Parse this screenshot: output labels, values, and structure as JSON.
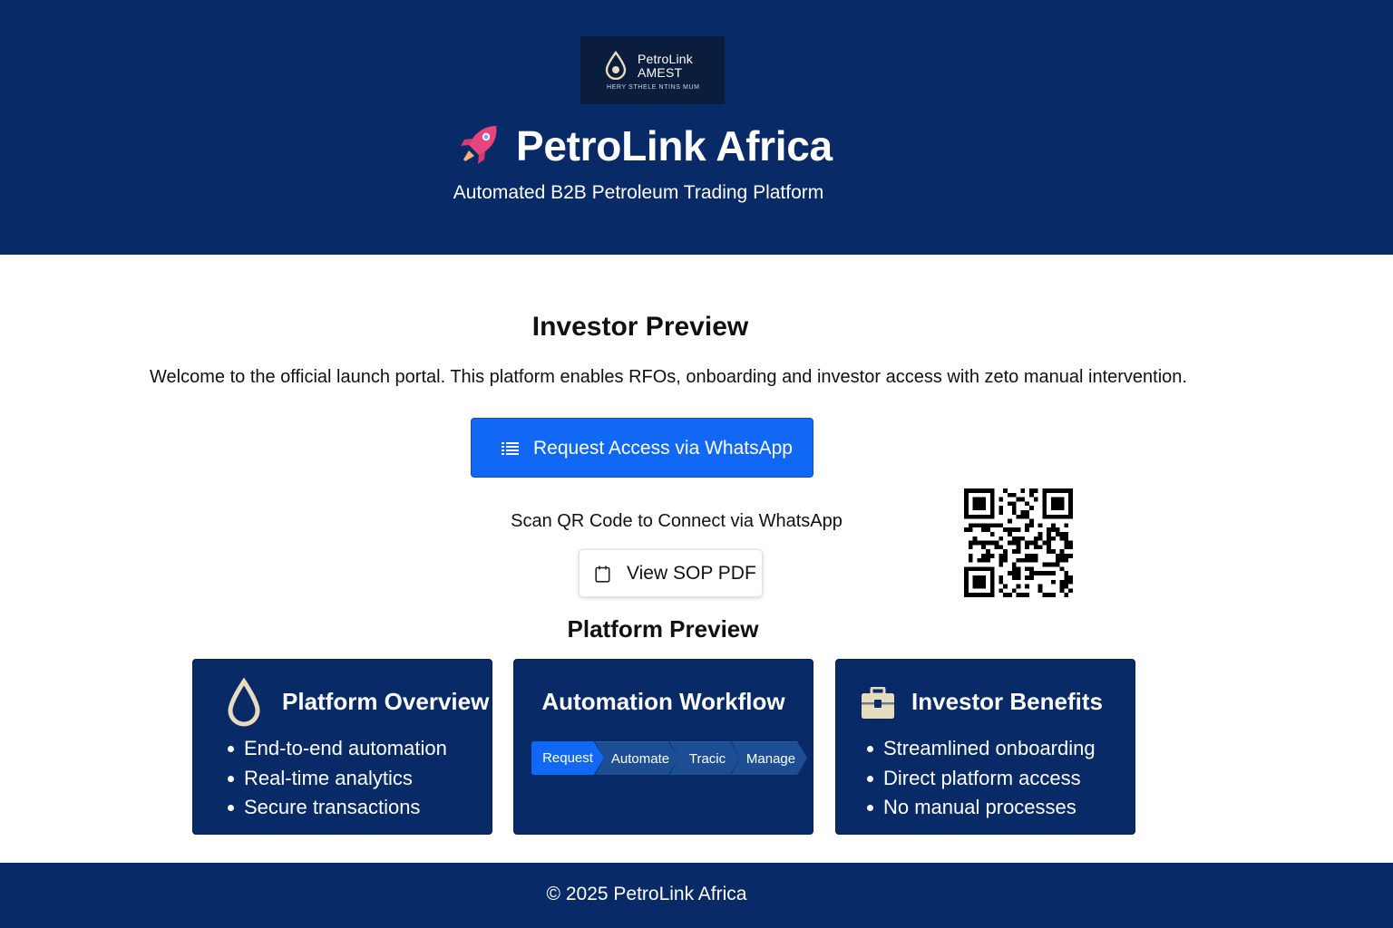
{
  "header": {
    "logo": {
      "name_line1": "PetroLink",
      "name_line2": "AMEST",
      "tagline": "HERY STHELE NTINS MUM"
    },
    "title": "PetroLink Africa",
    "subtitle": "Automated B2B Petroleum Trading Platform",
    "icons": {
      "title_icon": "rocket-icon",
      "logo_icon": "oil-drop-icon"
    }
  },
  "main": {
    "section_title": "Investor Preview",
    "intro": "Welcome to the official launch portal. This platform enables RFOs, onboarding and investor access with zeto manual intervention.",
    "whatsapp_button": {
      "label": "Request Access via WhatsApp",
      "icon": "list-icon"
    },
    "qr_caption": "Scan QR Code to Connect via WhatsApp",
    "sop_button": {
      "label": "View SOP PDF",
      "icon": "document-icon"
    },
    "qr_icon": "qr-code-icon",
    "preview_title": "Platform Preview"
  },
  "cards": [
    {
      "title": "Platform Overview",
      "icon": "drop-icon",
      "items": [
        "End-to-end automation",
        "Real-time analytics",
        "Secure transactions"
      ]
    },
    {
      "title": "Automation Workflow",
      "steps": [
        "Request",
        "Automate",
        "Tracic",
        "Manage"
      ]
    },
    {
      "title": "Investor Benefits",
      "icon": "briefcase-icon",
      "items": [
        "Streamlined onboarding",
        "Direct platform access",
        "No manual processes"
      ]
    }
  ],
  "footer": {
    "text": "© 2025 PetroLink Africa"
  },
  "colors": {
    "brand_navy": "#082a66",
    "accent_blue": "#1168f5",
    "step_blue": "#1d4e93",
    "logo_bg": "#0b1d3d",
    "icon_cream": "#e8dcc0"
  }
}
